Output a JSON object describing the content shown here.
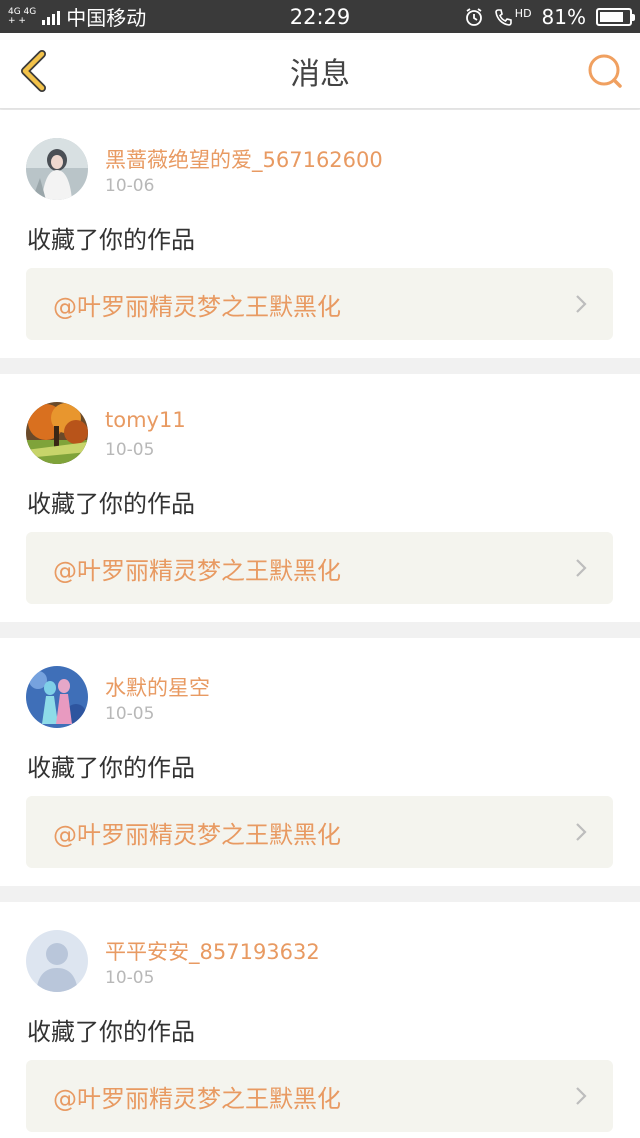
{
  "status_bar": {
    "network_top": "4G 4G",
    "network_bottom": "+ +",
    "carrier": "中国移动",
    "time": "22:29",
    "hd_label": "HD",
    "battery_text": "81%",
    "battery_level": 0.81
  },
  "nav": {
    "title": "消息",
    "back_icon": "chevron-left-icon",
    "search_icon": "search-icon",
    "accent_color": "#f0a060"
  },
  "notifications": [
    {
      "avatar": "avatar-girl-white-dress",
      "username": "黑蔷薇绝望的爱_567162600",
      "date": "10-06",
      "action": "收藏了你的作品",
      "work_title": "@叶罗丽精灵梦之王默黑化"
    },
    {
      "avatar": "avatar-autumn-tree",
      "username": "tomy11",
      "date": "10-05",
      "action": "收藏了你的作品",
      "work_title": "@叶罗丽精灵梦之王默黑化"
    },
    {
      "avatar": "avatar-two-dolls",
      "username": "水默的星空",
      "date": "10-05",
      "action": "收藏了你的作品",
      "work_title": "@叶罗丽精灵梦之王默黑化"
    },
    {
      "avatar": "avatar-default-person",
      "username": "平平安安_857193632",
      "date": "10-05",
      "action": "收藏了你的作品",
      "work_title": "@叶罗丽精灵梦之王默黑化"
    }
  ]
}
